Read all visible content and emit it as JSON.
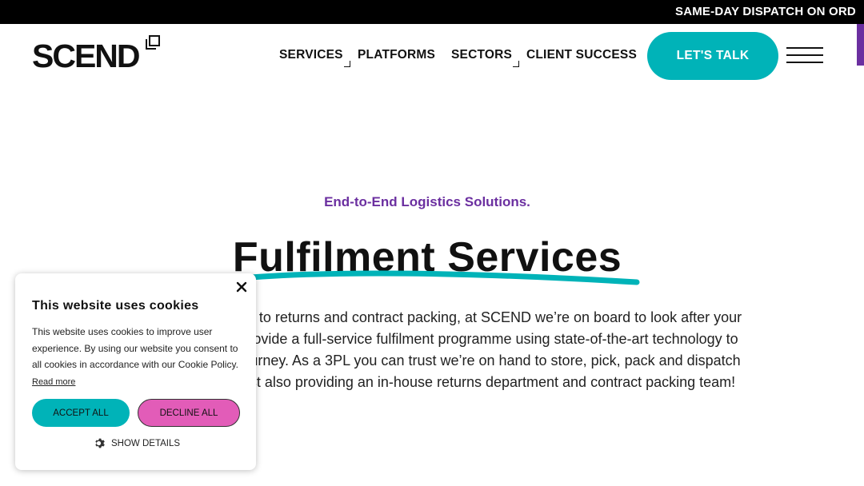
{
  "topbar": {
    "text": "SAME-DAY DISPATCH ON ORD"
  },
  "header": {
    "logo": "SCEND",
    "nav": [
      {
        "label": "SERVICES",
        "has_submenu": true
      },
      {
        "label": "PLATFORMS",
        "has_submenu": false
      },
      {
        "label": "SECTORS",
        "has_submenu": true
      },
      {
        "label": "CLIENT SUCCESS",
        "has_submenu": false
      }
    ],
    "cta_label": "LET'S TALK",
    "menu_icon": "hamburger-icon"
  },
  "hero": {
    "eyebrow": "End-to-End Logistics Solutions.",
    "title": "Fulfilment Services",
    "body_lines": [
      "rough to returns and contract packing, at SCEND we’re on board to look after your",
      "ID provide a full-service fulfilment programme using state-of-the-art technology to",
      "se journey. As a 3PL you can trust we’re on hand to store, pick, pack and dispatch",
      "whilst also providing an in-house returns department and contract packing team!"
    ]
  },
  "cookie_banner": {
    "title": "This website uses cookies",
    "body": "This website uses cookies to improve user experience. By using our website you consent to all cookies in accordance with our Cookie Policy.",
    "read_more": "Read more",
    "accept_label": "ACCEPT ALL",
    "decline_label": "DECLINE ALL",
    "show_details_label": "SHOW DETAILS",
    "close_icon": "close-icon",
    "details_icon": "gear-icon"
  },
  "colors": {
    "brand_teal": "#00b3b8",
    "brand_purple": "#6b2fa0",
    "decline_pink": "#e25cb8",
    "topbar_black": "#000000"
  }
}
